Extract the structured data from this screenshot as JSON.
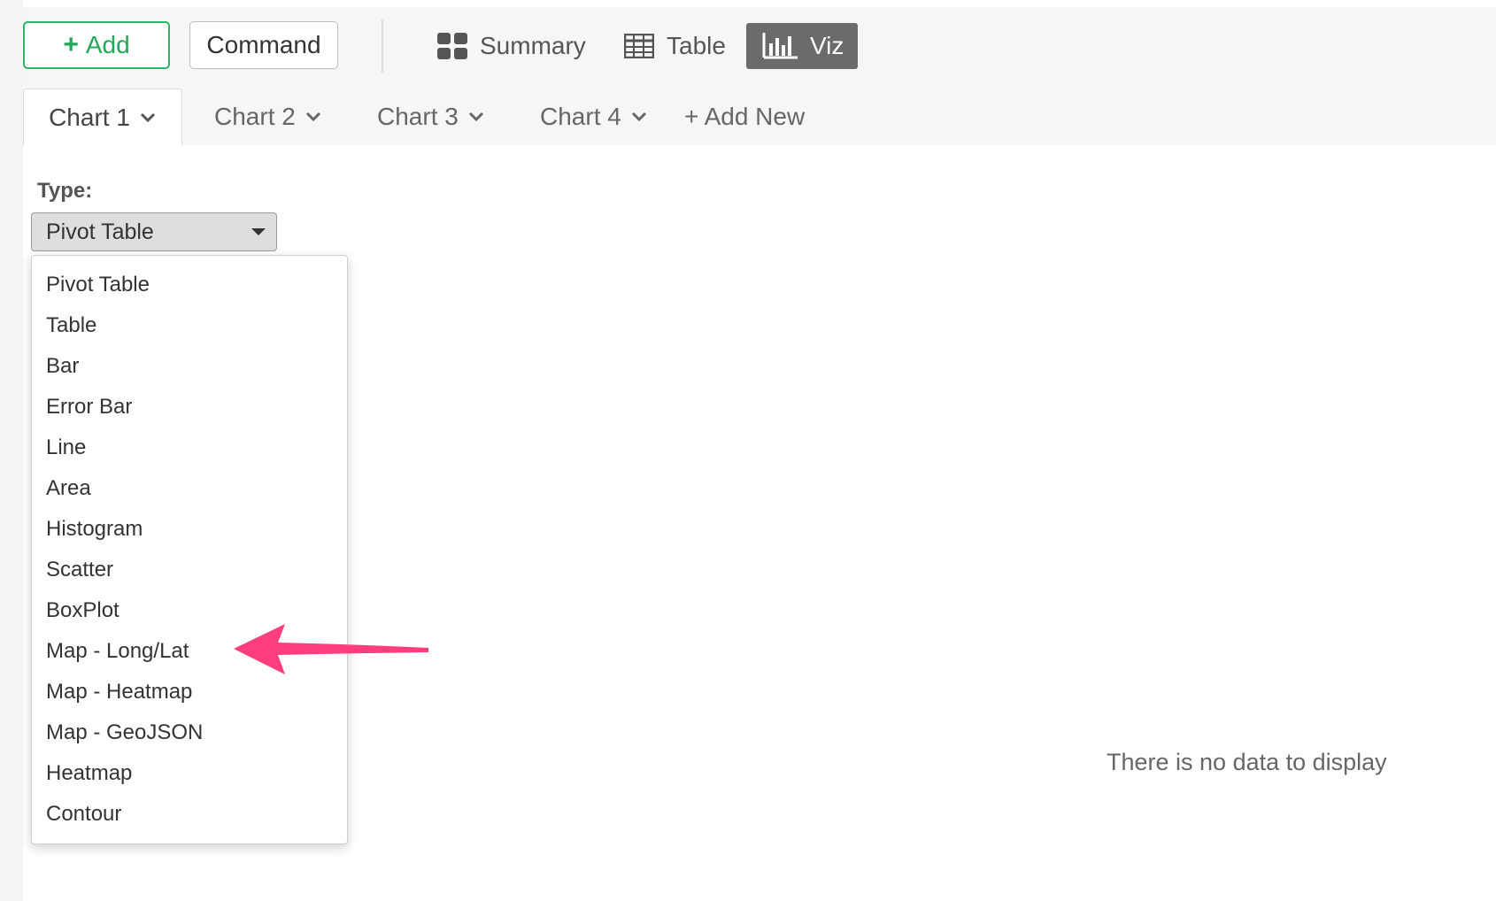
{
  "toolbar": {
    "add_label": "Add",
    "command_label": "Command",
    "views": [
      {
        "label": "Summary",
        "icon": "summary-grid-icon"
      },
      {
        "label": "Table",
        "icon": "table-icon"
      },
      {
        "label": "Viz",
        "icon": "bar-chart-icon",
        "active": true
      }
    ]
  },
  "tabs": [
    {
      "label": "Chart 1",
      "active": true
    },
    {
      "label": "Chart 2"
    },
    {
      "label": "Chart 3"
    },
    {
      "label": "Chart 4"
    }
  ],
  "add_new_label": "+ Add New",
  "type_label": "Type:",
  "type_select": {
    "value": "Pivot Table"
  },
  "type_options": [
    "Pivot Table",
    "Table",
    "Bar",
    "Error Bar",
    "Line",
    "Area",
    "Histogram",
    "Scatter",
    "BoxPlot",
    "Map - Long/Lat",
    "Map - Heatmap",
    "Map - GeoJSON",
    "Heatmap",
    "Contour"
  ],
  "empty_message": "There is no data to display",
  "colors": {
    "accent_green": "#2db665",
    "viz_active_bg": "#6b6b6b",
    "annotation_arrow": "#ff3d7f"
  }
}
